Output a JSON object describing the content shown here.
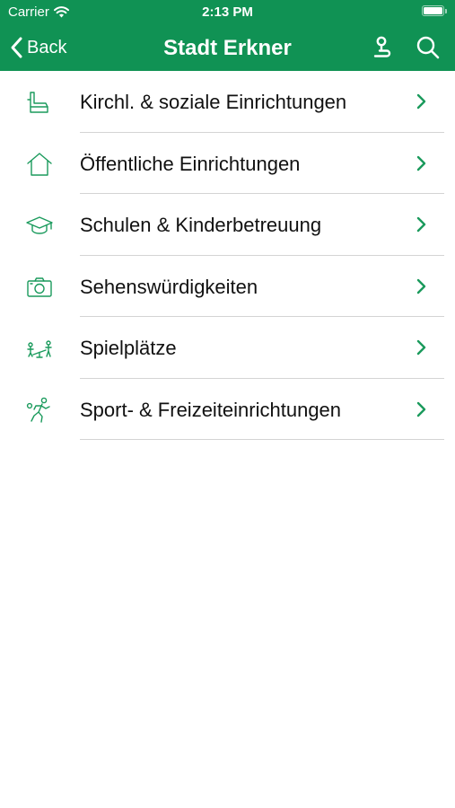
{
  "status_bar": {
    "carrier": "Carrier",
    "time": "2:13 PM"
  },
  "nav": {
    "back_label": "Back",
    "title": "Stadt Erkner"
  },
  "colors": {
    "brand": "#109254",
    "accent": "#1a9a5c"
  },
  "items": [
    {
      "label": "Kirchl. & soziale Einrichtungen",
      "icon": "armchair-icon"
    },
    {
      "label": "Öffentliche Einrichtungen",
      "icon": "house-icon"
    },
    {
      "label": "Schulen & Kinderbetreuung",
      "icon": "graduation-cap-icon"
    },
    {
      "label": "Sehenswürdigkeiten",
      "icon": "camera-icon"
    },
    {
      "label": "Spielplätze",
      "icon": "playground-icon"
    },
    {
      "label": "Sport- & Freizeiteinrichtungen",
      "icon": "runner-icon"
    }
  ]
}
